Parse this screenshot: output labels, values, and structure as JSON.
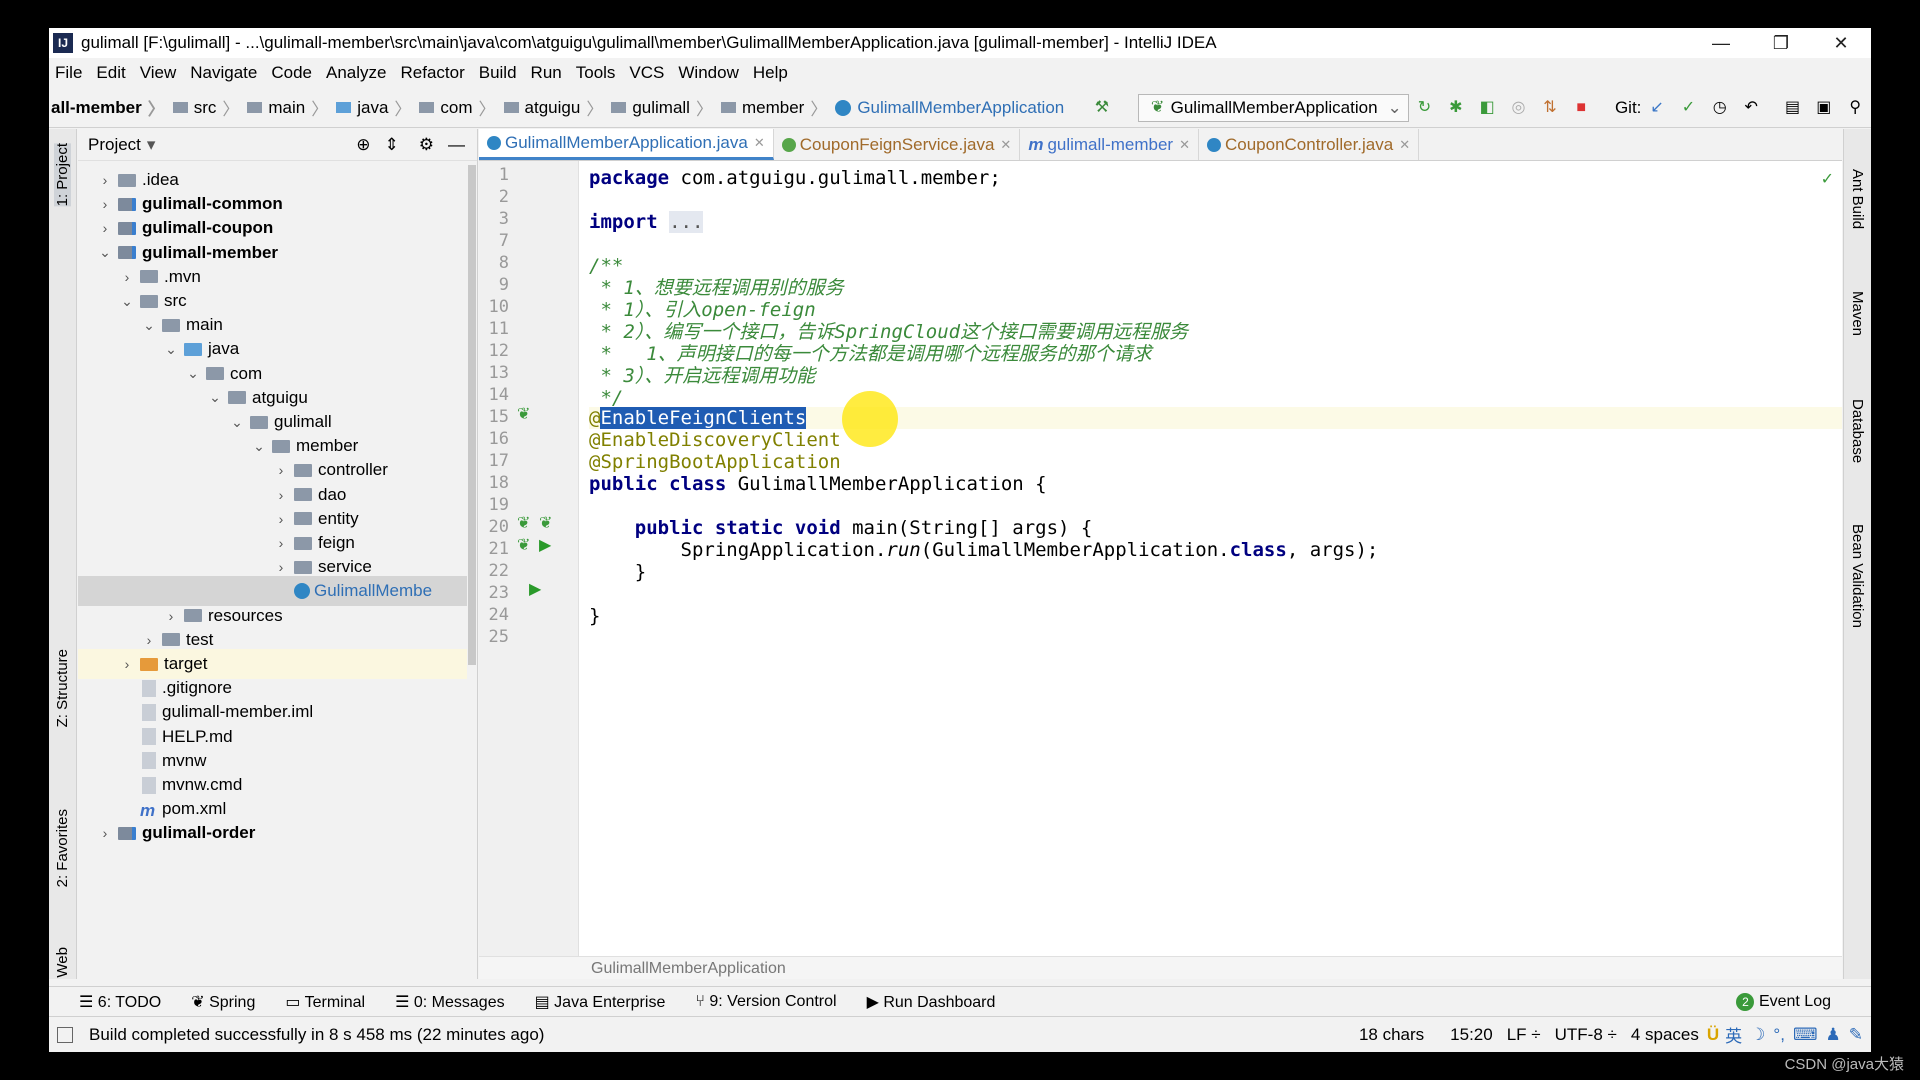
{
  "window": {
    "title": "gulimall [F:\\gulimall] - ...\\gulimall-member\\src\\main\\java\\com\\atguigu\\gulimall\\member\\GulimallMemberApplication.java [gulimall-member] - IntelliJ IDEA",
    "app_icon": "IJ"
  },
  "menu": [
    "File",
    "Edit",
    "View",
    "Navigate",
    "Code",
    "Analyze",
    "Refactor",
    "Build",
    "Run",
    "Tools",
    "VCS",
    "Window",
    "Help"
  ],
  "breadcrumbs": [
    "all-member",
    "src",
    "main",
    "java",
    "com",
    "atguigu",
    "gulimall",
    "member",
    "GulimallMemberApplication"
  ],
  "run_config": "GulimallMemberApplication",
  "git_label": "Git:",
  "left_strip": {
    "project": "1: Project",
    "structure": "Z: Structure",
    "favorites": "2: Favorites",
    "web": "Web"
  },
  "right_strip": {
    "ant": "Ant Build",
    "maven": "Maven",
    "database": "Database",
    "bean": "Bean Validation"
  },
  "project_panel": {
    "title": "Project",
    "tree": [
      {
        "label": ".idea",
        "indent": 1,
        "arrow": "›",
        "icon": "folder",
        "bold": false
      },
      {
        "label": "gulimall-common",
        "indent": 1,
        "arrow": "›",
        "icon": "mod",
        "bold": true
      },
      {
        "label": "gulimall-coupon",
        "indent": 1,
        "arrow": "›",
        "icon": "mod",
        "bold": true
      },
      {
        "label": "gulimall-member",
        "indent": 1,
        "arrow": "⌄",
        "icon": "mod",
        "bold": true
      },
      {
        "label": ".mvn",
        "indent": 2,
        "arrow": "›",
        "icon": "folder",
        "bold": false
      },
      {
        "label": "src",
        "indent": 2,
        "arrow": "⌄",
        "icon": "folder",
        "bold": false
      },
      {
        "label": "main",
        "indent": 3,
        "arrow": "⌄",
        "icon": "folder",
        "bold": false
      },
      {
        "label": "java",
        "indent": 4,
        "arrow": "⌄",
        "icon": "blue",
        "bold": false
      },
      {
        "label": "com",
        "indent": 5,
        "arrow": "⌄",
        "icon": "folder",
        "bold": false
      },
      {
        "label": "atguigu",
        "indent": 6,
        "arrow": "⌄",
        "icon": "folder",
        "bold": false
      },
      {
        "label": "gulimall",
        "indent": 7,
        "arrow": "⌄",
        "icon": "folder",
        "bold": false
      },
      {
        "label": "member",
        "indent": 8,
        "arrow": "⌄",
        "icon": "folder",
        "bold": false
      },
      {
        "label": "controller",
        "indent": 9,
        "arrow": "›",
        "icon": "folder",
        "bold": false
      },
      {
        "label": "dao",
        "indent": 9,
        "arrow": "›",
        "icon": "folder",
        "bold": false
      },
      {
        "label": "entity",
        "indent": 9,
        "arrow": "›",
        "icon": "folder",
        "bold": false
      },
      {
        "label": "feign",
        "indent": 9,
        "arrow": "›",
        "icon": "folder",
        "bold": false
      },
      {
        "label": "service",
        "indent": 9,
        "arrow": "›",
        "icon": "folder",
        "bold": false
      },
      {
        "label": "GulimallMembe",
        "indent": 9,
        "arrow": "",
        "icon": "class",
        "bold": false,
        "selected": true
      },
      {
        "label": "resources",
        "indent": 4,
        "arrow": "›",
        "icon": "folder",
        "bold": false
      },
      {
        "label": "test",
        "indent": 3,
        "arrow": "›",
        "icon": "folder",
        "bold": false
      },
      {
        "label": "target",
        "indent": 2,
        "arrow": "›",
        "icon": "orange",
        "bold": false,
        "highlight": true
      },
      {
        "label": ".gitignore",
        "indent": 2,
        "arrow": "",
        "icon": "file",
        "bold": false
      },
      {
        "label": "gulimall-member.iml",
        "indent": 2,
        "arrow": "",
        "icon": "file",
        "bold": false
      },
      {
        "label": "HELP.md",
        "indent": 2,
        "arrow": "",
        "icon": "file",
        "bold": false
      },
      {
        "label": "mvnw",
        "indent": 2,
        "arrow": "",
        "icon": "file",
        "bold": false
      },
      {
        "label": "mvnw.cmd",
        "indent": 2,
        "arrow": "",
        "icon": "file",
        "bold": false
      },
      {
        "label": "pom.xml",
        "indent": 2,
        "arrow": "",
        "icon": "maven",
        "bold": false
      },
      {
        "label": "gulimall-order",
        "indent": 1,
        "arrow": "›",
        "icon": "mod",
        "bold": true
      }
    ]
  },
  "tabs": [
    {
      "label": "GulimallMemberApplication.java",
      "active": true,
      "color": "#2f86c4",
      "icon": "class-icon"
    },
    {
      "label": "CouponFeignService.java",
      "active": false,
      "color": "#57a64a",
      "icon": "interface-icon"
    },
    {
      "label": "gulimall-member",
      "active": false,
      "color": "#3f71c8",
      "icon": "maven-icon"
    },
    {
      "label": "CouponController.java",
      "active": false,
      "color": "#2f86c4",
      "icon": "class-icon"
    }
  ],
  "line_numbers": [
    "1",
    "2",
    "3",
    "7",
    "8",
    "9",
    "10",
    "11",
    "12",
    "13",
    "14",
    "15",
    "16",
    "17",
    "18",
    "19",
    "20",
    "21",
    "22",
    "23",
    "24",
    "25"
  ],
  "code": {
    "l1a": "package",
    "l1b": " com.atguigu.gulimall.member;",
    "l3a": "import",
    "l3b": "...",
    "c1": "/**",
    "c2": " * 1、想要远程调用别的服务",
    "c3": " * 1）、引入open-feign",
    "c4": " * 2）、编写一个接口，告诉SpringCloud这个接口需要调用远程服务",
    "c5": " *   1、声明接口的每一个方法都是调用哪个远程服务的那个请求",
    "c6": " * 3）、开启远程调用功能",
    "c7": " */",
    "a1a": "@",
    "a1b": "EnableFeignClients",
    "a2": "@EnableDiscoveryClient",
    "a3": "@SpringBootApplication",
    "cls_kw": "public class",
    "cls_name": " GulimallMemberApplication {",
    "main_kw": "public static void",
    "main_rest": " main(String[] args) {",
    "run_a": "SpringApplication.",
    "run_b": "run",
    "run_c": "(GulimallMemberApplication.",
    "run_d": "class",
    "run_e": ", args);",
    "close1": "}",
    "close2": "}"
  },
  "editor_breadcrumb": "GulimallMemberApplication",
  "toolwindows": [
    "6: TODO",
    "Spring",
    "Terminal",
    "0: Messages",
    "Java Enterprise",
    "9: Version Control",
    "Run Dashboard",
    "Event Log"
  ],
  "event_log_badge": "2",
  "status": {
    "message": "Build completed successfully in 8 s 458 ms (22 minutes ago)",
    "chars": "18 chars",
    "position": "15:20",
    "line_sep": "LF ÷",
    "encoding": "UTF-8 ÷",
    "indent": "4 spaces",
    "ime": "英"
  },
  "watermark": "CSDN @java大猿",
  "colors": {
    "accent": "#4083c9",
    "selection": "#1f5cb3",
    "comment": "#3b8a3b",
    "keyword": "#000080",
    "annotation": "#808000"
  }
}
